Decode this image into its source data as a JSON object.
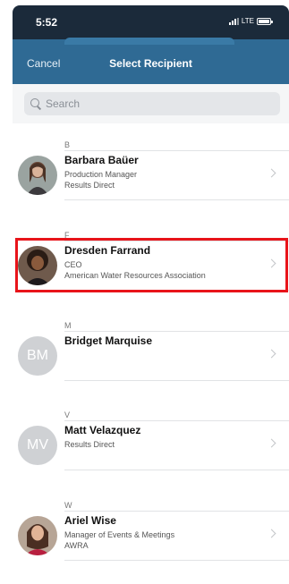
{
  "status": {
    "time": "5:52",
    "network": "LTE"
  },
  "header": {
    "cancel_label": "Cancel",
    "title": "Select Recipient"
  },
  "search": {
    "placeholder": "Search"
  },
  "recipients": [
    {
      "section": "B",
      "name": "Barbara Baüer",
      "line1": "Production Manager",
      "line2": "Results Direct",
      "initials": ""
    },
    {
      "section": "F",
      "name": "Dresden Farrand",
      "line1": "CEO",
      "line2": "American Water Resources Association",
      "initials": ""
    },
    {
      "section": "M",
      "name": "Bridget Marquise",
      "line1": "",
      "line2": "",
      "initials": "BM"
    },
    {
      "section": "V",
      "name": "Matt Velazquez",
      "line1": "Results Direct",
      "line2": "",
      "initials": "MV"
    },
    {
      "section": "W",
      "name": "Ariel Wise",
      "line1": "Manager of Events & Meetings",
      "line2": "AWRA",
      "initials": ""
    }
  ],
  "colors": {
    "header": "#2f6a94",
    "highlight": "#e8141a"
  }
}
